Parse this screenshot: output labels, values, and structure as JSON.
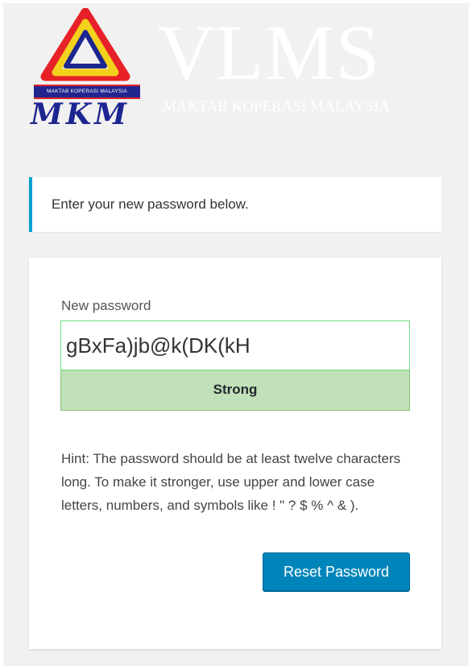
{
  "branding": {
    "logo_band_text": "MAKTAB KOPERASI MALAYSIA",
    "logo_mkm_text": "MKM",
    "site_title": "VLMS",
    "site_subtitle": "MAKTAB KOPERASI MALAYSIA"
  },
  "message": {
    "text": "Enter your new password below."
  },
  "form": {
    "label": "New password",
    "password_value": "gBxFa)jb@k(DK(kH",
    "strength": "Strong",
    "hint": "Hint: The password should be at least twelve characters long. To make it stronger, use upper and lower case letters, numbers, and symbols like ! \" ? $ % ^ & ).",
    "submit_label": "Reset Password"
  },
  "colors": {
    "accent": "#00a0d2",
    "button": "#0085ba",
    "strength_bg": "#c1e1b9",
    "page_bg": "#f1f1f1"
  }
}
